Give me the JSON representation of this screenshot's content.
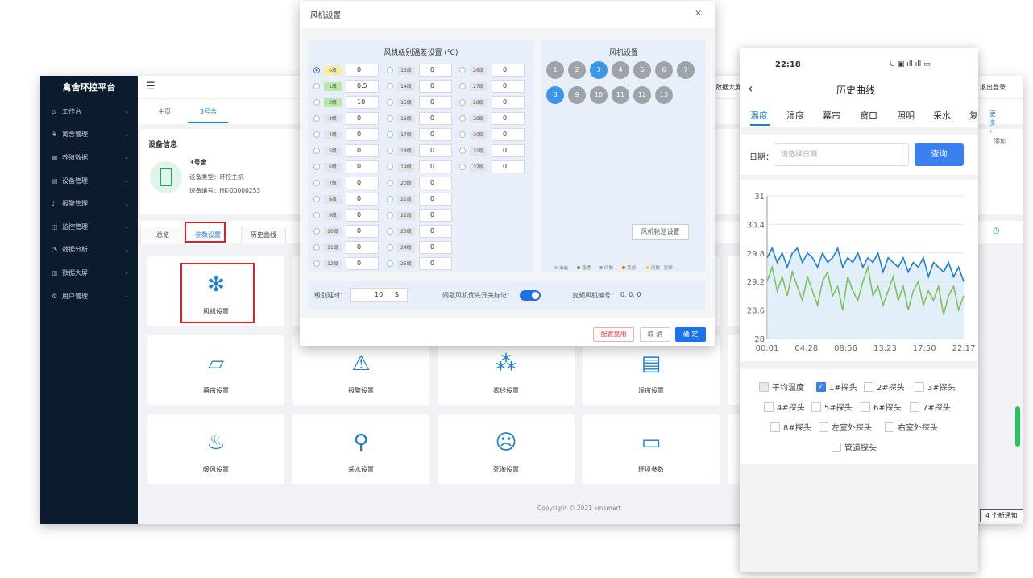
{
  "platform": {
    "brand": "禽舍环控平台",
    "menu_icon": "hamburger-icon",
    "sidebar": [
      {
        "label": "工作台",
        "icon": "home-icon"
      },
      {
        "label": "禽舍管理",
        "icon": "bird-icon"
      },
      {
        "label": "养殖数据",
        "icon": "grid-icon"
      },
      {
        "label": "设备管理",
        "icon": "device-icon"
      },
      {
        "label": "报警管理",
        "icon": "bell-icon"
      },
      {
        "label": "监控管理",
        "icon": "camera-icon"
      },
      {
        "label": "数据分析",
        "icon": "chart-icon"
      },
      {
        "label": "数据大屏",
        "icon": "bar-icon"
      },
      {
        "label": "用户管理",
        "icon": "user-icon"
      }
    ],
    "topbar_right": [
      "数据大屏",
      "退出登录"
    ],
    "page_tabs": [
      "主页",
      "3号舍"
    ],
    "device_info": {
      "heading": "设备信息",
      "name": "3号舍",
      "type": "设备类型：环控主机",
      "code": "设备编号：HK-00000253",
      "add": "添加"
    },
    "sub_tabs": [
      "总览",
      "参数设置",
      "历史曲线"
    ],
    "tiles": [
      {
        "label": "风机设置",
        "icon": "fan-icon",
        "glyph": "✻"
      },
      {
        "label": "幕帘设置",
        "icon": "curtain-icon",
        "glyph": "▱"
      },
      {
        "label": "报警设置",
        "icon": "alarm-light-icon",
        "glyph": "⚠"
      },
      {
        "label": "雾线设置",
        "icon": "mist-icon",
        "glyph": "⁂"
      },
      {
        "label": "湿帘设置",
        "icon": "wet-curtain-icon",
        "glyph": "▤"
      },
      {
        "label": "暖风设置",
        "icon": "heat-icon",
        "glyph": "♨"
      },
      {
        "label": "采水设置",
        "icon": "water-tap-icon",
        "glyph": "⚲"
      },
      {
        "label": "死淘设置",
        "icon": "dead-cull-icon",
        "glyph": "☹"
      },
      {
        "label": "环境参数",
        "icon": "monitor-leaf-icon",
        "glyph": "▭"
      }
    ],
    "copyright": "Copyright © 2021 smsmart",
    "notice": "4 个新通知"
  },
  "modal": {
    "title": "风机设置",
    "level_panel_title": "风机级别温差设置 (℃)",
    "levels_col1": [
      {
        "tag": "0级",
        "value": "0",
        "color": "y",
        "selected": true
      },
      {
        "tag": "1级",
        "value": "0.5",
        "color": "g"
      },
      {
        "tag": "2级",
        "value": "10",
        "color": "g"
      },
      {
        "tag": "3级",
        "value": "0"
      },
      {
        "tag": "4级",
        "value": "0"
      },
      {
        "tag": "5级",
        "value": "0"
      },
      {
        "tag": "6级",
        "value": "0"
      },
      {
        "tag": "7级",
        "value": "0"
      },
      {
        "tag": "8级",
        "value": "0"
      },
      {
        "tag": "9级",
        "value": "0"
      },
      {
        "tag": "10级",
        "value": "0"
      },
      {
        "tag": "11级",
        "value": "0"
      },
      {
        "tag": "12级",
        "value": "0"
      }
    ],
    "levels_col2": [
      {
        "tag": "13级",
        "value": "0"
      },
      {
        "tag": "14级",
        "value": "0"
      },
      {
        "tag": "15级",
        "value": "0"
      },
      {
        "tag": "16级",
        "value": "0"
      },
      {
        "tag": "17级",
        "value": "0"
      },
      {
        "tag": "18级",
        "value": "0"
      },
      {
        "tag": "19级",
        "value": "0"
      },
      {
        "tag": "20级",
        "value": "0"
      },
      {
        "tag": "21级",
        "value": "0"
      },
      {
        "tag": "22级",
        "value": "0"
      },
      {
        "tag": "23级",
        "value": "0"
      },
      {
        "tag": "24级",
        "value": "0"
      },
      {
        "tag": "25级",
        "value": "0"
      }
    ],
    "levels_col3": [
      {
        "tag": "26级",
        "value": "0"
      },
      {
        "tag": "27级",
        "value": "0"
      },
      {
        "tag": "28级",
        "value": "0"
      },
      {
        "tag": "29级",
        "value": "0"
      },
      {
        "tag": "30级",
        "value": "0"
      },
      {
        "tag": "31级",
        "value": "0"
      },
      {
        "tag": "32级",
        "value": "0"
      }
    ],
    "fan_panel_title": "风机设置",
    "fans": [
      {
        "n": "1",
        "on": false
      },
      {
        "n": "2",
        "on": false
      },
      {
        "n": "3",
        "on": true
      },
      {
        "n": "4",
        "on": false
      },
      {
        "n": "5",
        "on": false
      },
      {
        "n": "6",
        "on": false
      },
      {
        "n": "7",
        "on": false
      },
      {
        "n": "8",
        "on": true
      },
      {
        "n": "9",
        "on": false
      },
      {
        "n": "10",
        "on": false
      },
      {
        "n": "11",
        "on": false
      },
      {
        "n": "12",
        "on": false
      },
      {
        "n": "13",
        "on": false
      }
    ],
    "loop_button": "风机轮巡设置",
    "legend": [
      {
        "label": "未选",
        "color": "#bbbbbb"
      },
      {
        "label": "普通",
        "color": "#4caf50"
      },
      {
        "label": "间歇",
        "color": "#64b5f6"
      },
      {
        "label": "变频",
        "color": "#ef6c00"
      },
      {
        "label": "间歇+变频",
        "color": "#fbc02d"
      }
    ],
    "delay_label": "级别延时：",
    "delay_value": "10",
    "delay_unit": "S",
    "intermittent_label": "间歇风机优先开关标记：",
    "inverter_label": "变频风机编号：",
    "inverter_value": "0, 0, 0",
    "btn_copy": "配置复用",
    "btn_cancel": "取 消",
    "btn_ok": "确 定"
  },
  "phone": {
    "time": "22:18",
    "status_icons": "⏾ ▣ ıll ıll ▭",
    "title": "历史曲线",
    "tabs": [
      "温度",
      "湿度",
      "幕帘",
      "窗口",
      "照明",
      "采水",
      "复"
    ],
    "more": "更多 ›",
    "date_label": "日期：",
    "date_placeholder": "请选择日期",
    "query": "查询",
    "checkboxes": [
      {
        "label": "平均温度",
        "state": "dis"
      },
      {
        "label": "1#探头",
        "state": "on"
      },
      {
        "label": "2#探头",
        "state": "off"
      },
      {
        "label": "3#探头",
        "state": "off"
      },
      {
        "label": "4#探头",
        "state": "off"
      },
      {
        "label": "5#探头",
        "state": "off"
      },
      {
        "label": "6#探头",
        "state": "off"
      },
      {
        "label": "7#探头",
        "state": "off"
      },
      {
        "label": "8#探头",
        "state": "off"
      },
      {
        "label": "左室外探头",
        "state": "off"
      },
      {
        "label": "右室外探头",
        "state": "off"
      },
      {
        "label": "管道探头",
        "state": "off"
      }
    ]
  },
  "chart_data": {
    "type": "line",
    "x_ticks": [
      "00:01",
      "04:28",
      "08:56",
      "13:23",
      "17:50",
      "22:17"
    ],
    "y_ticks": [
      28.0,
      28.6,
      29.2,
      29.8,
      30.4,
      31.0
    ],
    "ylim": [
      28.0,
      31.0
    ],
    "grid": true,
    "series": [
      {
        "color": "#1e7fd8",
        "fill": "#cfe4f7",
        "values": [
          29.7,
          29.9,
          29.6,
          29.8,
          29.5,
          29.8,
          29.9,
          29.6,
          29.8,
          29.7,
          29.5,
          29.8,
          29.6,
          29.7,
          29.9,
          29.5,
          29.7,
          29.6,
          29.8,
          29.5,
          29.7,
          29.6,
          29.8,
          29.4,
          29.7,
          29.6,
          29.5,
          29.7,
          29.4,
          29.6,
          29.5,
          29.7,
          29.3,
          29.6,
          29.5,
          29.4,
          29.6,
          29.3,
          29.5,
          29.2
        ]
      },
      {
        "color": "#7dc25a",
        "fill": "none",
        "values": [
          29.2,
          29.5,
          29.0,
          29.3,
          28.9,
          29.4,
          29.1,
          28.8,
          29.3,
          29.0,
          28.7,
          29.2,
          29.4,
          28.9,
          29.1,
          28.6,
          29.3,
          29.0,
          28.8,
          29.2,
          29.5,
          28.9,
          29.1,
          28.7,
          29.0,
          29.3,
          28.8,
          29.1,
          28.6,
          29.0,
          29.2,
          28.7,
          29.0,
          28.8,
          29.1,
          28.5,
          28.9,
          29.1,
          28.6,
          28.9
        ]
      }
    ]
  }
}
